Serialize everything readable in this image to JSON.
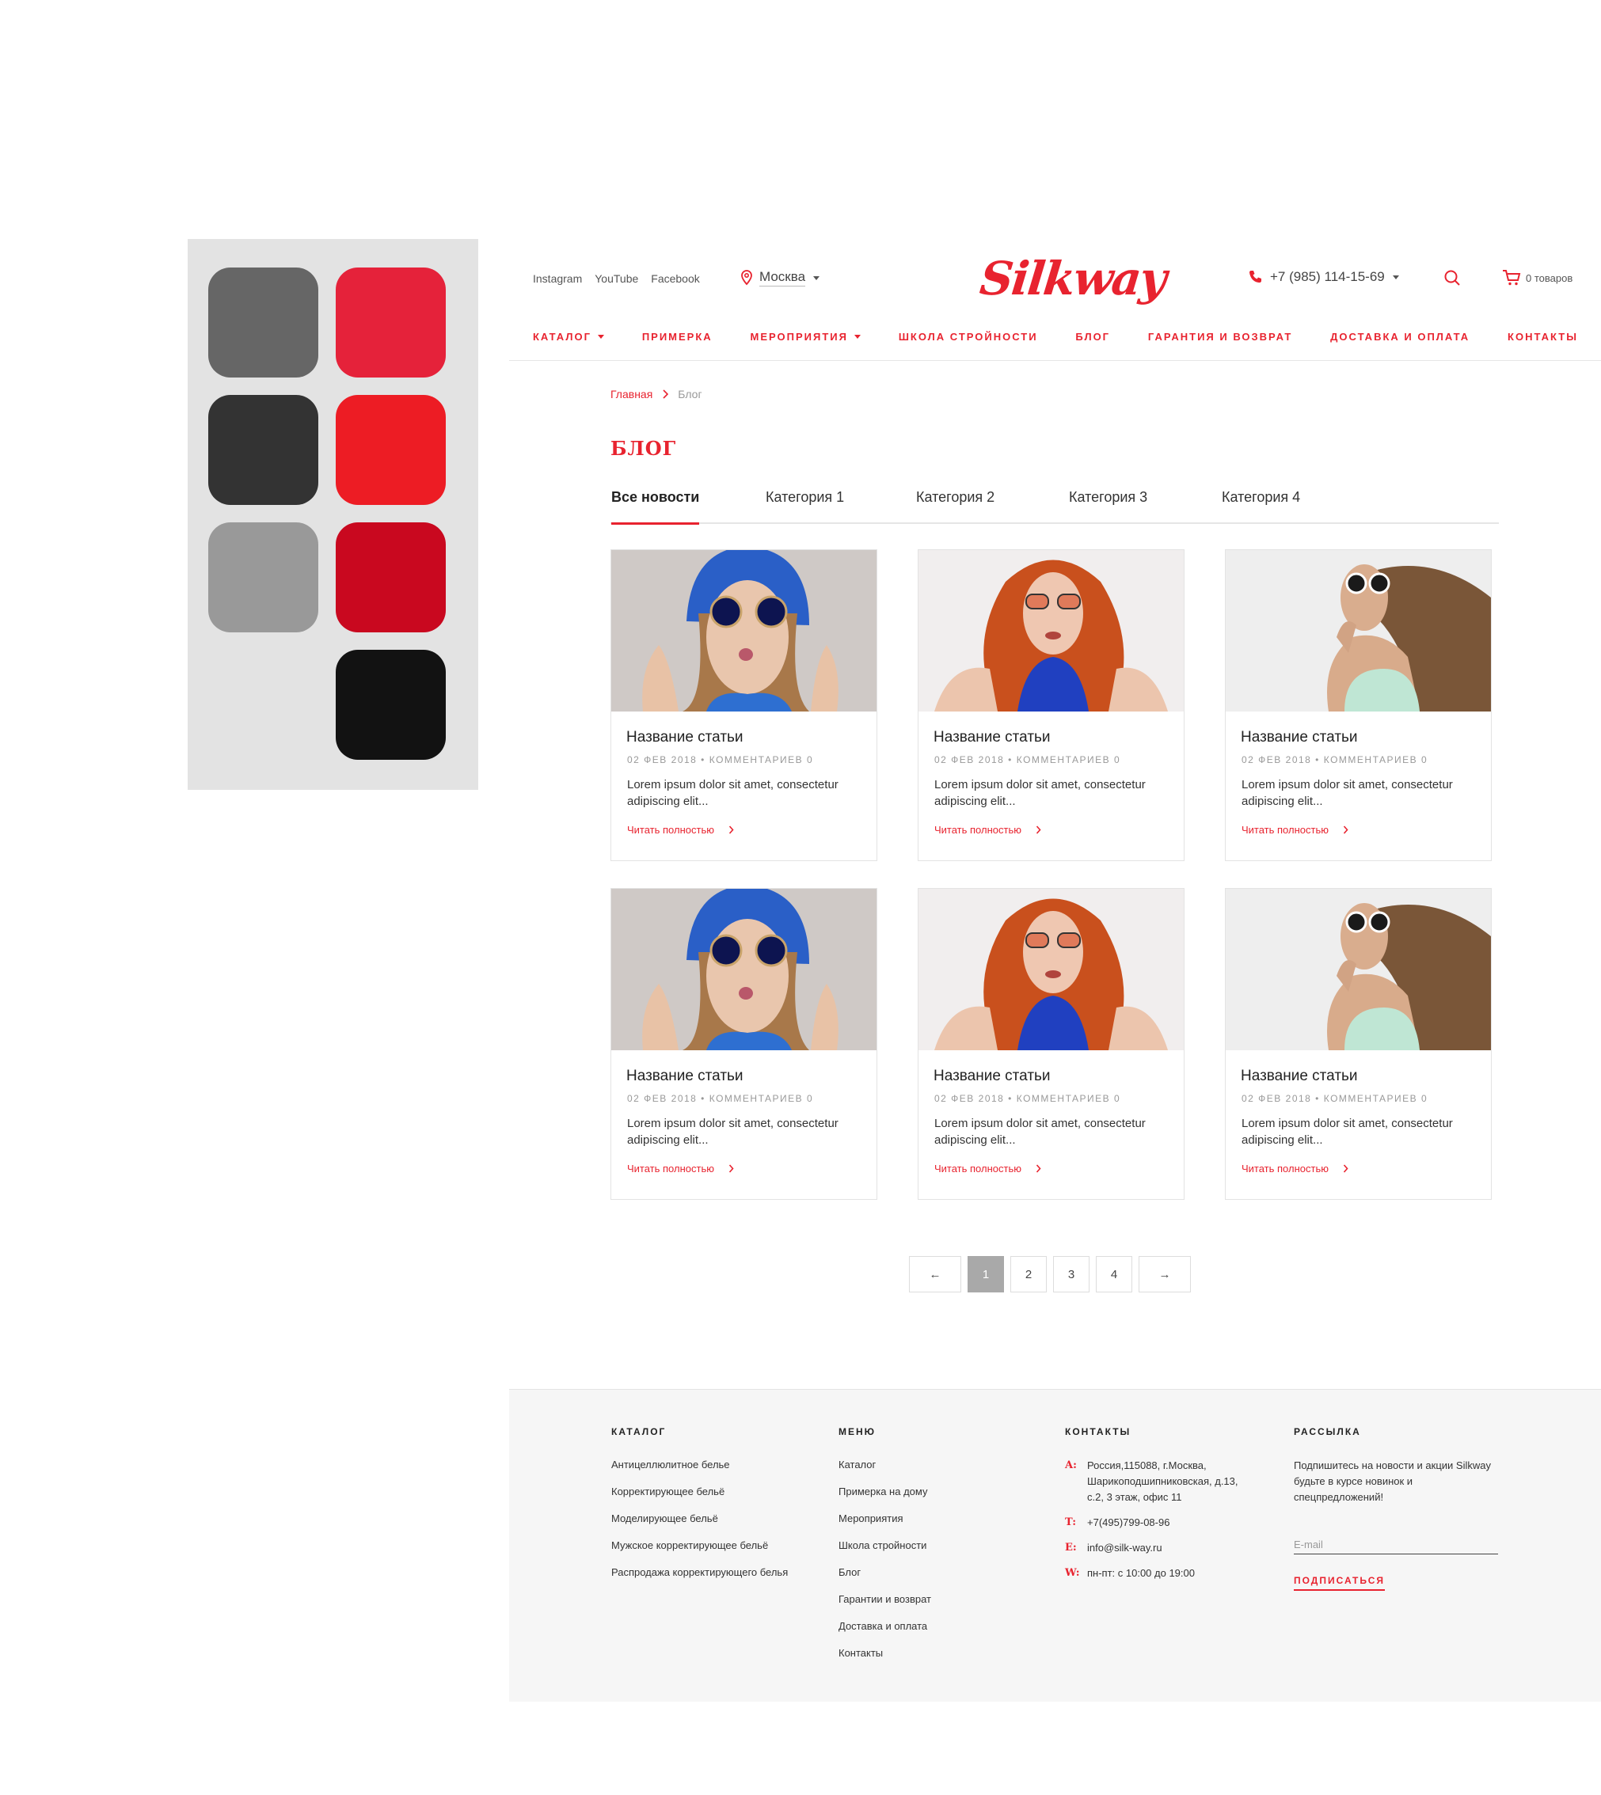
{
  "palette": {
    "swatches": [
      "#666666",
      "#e5223a",
      "#333333",
      "#ed1c24",
      "#999999",
      "#c9081f",
      "#121212"
    ]
  },
  "header": {
    "social": [
      "Instagram",
      "YouTube",
      "Facebook"
    ],
    "city": "Москва",
    "logo": "Silkway",
    "phone": "+7 (985) 114-15-69",
    "cart": "0 товаров"
  },
  "nav": [
    "КАТАЛОГ",
    "ПРИМЕРКА",
    "МЕРОПРИЯТИЯ",
    "ШКОЛА СТРОЙНОСТИ",
    "БЛОГ",
    "ГАРАНТИЯ И ВОЗВРАТ",
    "ДОСТАВКА И ОПЛАТА",
    "КОНТАКТЫ"
  ],
  "breadcrumb": {
    "home": "Главная",
    "current": "Блог"
  },
  "page_title": "БЛОГ",
  "tabs": [
    "Все новости",
    "Категория 1",
    "Категория 2",
    "Категория 3",
    "Категория 4"
  ],
  "articles": [
    {
      "title": "Название статьи",
      "meta": "02 ФЕВ 2018  •  КОММЕНТАРИЕВ 0",
      "excerpt": "Lorem ipsum dolor sit amet, consectetur adipiscing elit...",
      "more": "Читать полностью"
    },
    {
      "title": "Название статьи",
      "meta": "02 ФЕВ 2018  •  КОММЕНТАРИЕВ 0",
      "excerpt": "Lorem ipsum dolor sit amet, consectetur adipiscing elit...",
      "more": "Читать полностью"
    },
    {
      "title": "Название статьи",
      "meta": "02 ФЕВ 2018  •  КОММЕНТАРИЕВ 0",
      "excerpt": "Lorem ipsum dolor sit amet, consectetur adipiscing elit...",
      "more": "Читать полностью"
    },
    {
      "title": "Название статьи",
      "meta": "02 ФЕВ 2018  •  КОММЕНТАРИЕВ 0",
      "excerpt": "Lorem ipsum dolor sit amet, consectetur adipiscing elit...",
      "more": "Читать полностью"
    },
    {
      "title": "Название статьи",
      "meta": "02 ФЕВ 2018  •  КОММЕНТАРИЕВ 0",
      "excerpt": "Lorem ipsum dolor sit amet, consectetur adipiscing elit...",
      "more": "Читать полностью"
    },
    {
      "title": "Название статьи",
      "meta": "02 ФЕВ 2018  •  КОММЕНТАРИЕВ 0",
      "excerpt": "Lorem ipsum dolor sit amet, consectetur adipiscing elit...",
      "more": "Читать полностью"
    }
  ],
  "pagination": {
    "prev": "←",
    "pages": [
      "1",
      "2",
      "3",
      "4"
    ],
    "next": "→",
    "current": "1"
  },
  "footer": {
    "catalog": {
      "heading": "КАТАЛОГ",
      "links": [
        "Антицеллюлитное белье",
        "Корректирующее бельё",
        "Моделирующее бельё",
        "Мужское корректирующее бельё",
        "Распродажа корректирующего белья"
      ]
    },
    "menu": {
      "heading": "МЕНЮ",
      "links": [
        "Каталог",
        "Примерка на дому",
        "Мероприятия",
        "Школа стройности",
        "Блог",
        "Гарантии и возврат",
        "Доставка и оплата",
        "Контакты"
      ]
    },
    "contacts": {
      "heading": "КОНТАКТЫ",
      "rows": [
        {
          "k": "A:",
          "v": "Россия,115088, г.Москва, Шарикоподшипниковская, д.13, с.2, 3 этаж, офис 11"
        },
        {
          "k": "T:",
          "v": "+7(495)799-08-96"
        },
        {
          "k": "E:",
          "v": "info@silk-way.ru"
        },
        {
          "k": "W:",
          "v": "пн-пт: с 10:00 до 19:00"
        }
      ]
    },
    "newsletter": {
      "heading": "РАССЫЛКА",
      "text": "Подпишитесь на новости и акции Silkway будьте в курсе новинок и спецпредложений!",
      "placeholder": "E-mail",
      "button": "ПОДПИСАТЬСЯ"
    }
  },
  "colors": {
    "accent": "#e8232f"
  }
}
